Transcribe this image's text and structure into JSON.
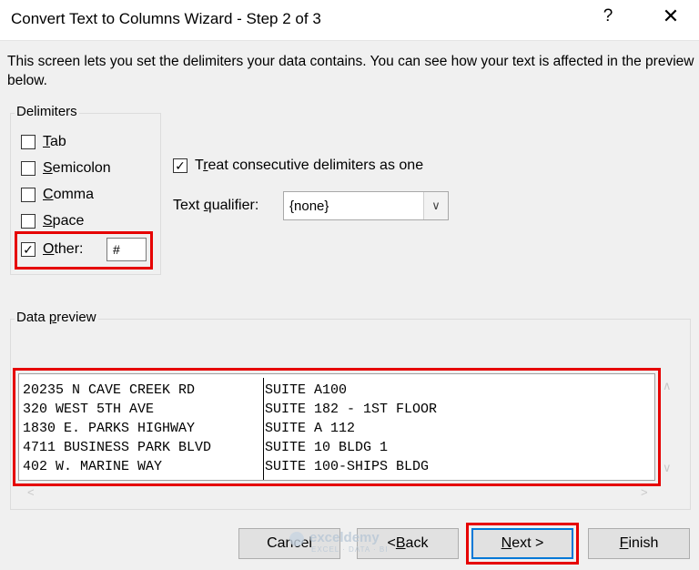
{
  "window": {
    "title": "Convert Text to Columns Wizard - Step 2 of 3",
    "help_glyph": "?",
    "close_glyph": "✕"
  },
  "description": "This screen lets you set the delimiters your data contains.  You can see how your text is affected in the preview below.",
  "delimiters": {
    "label": "Delimiters",
    "items": [
      {
        "key": "T",
        "rest": "ab",
        "checked": false
      },
      {
        "key": "S",
        "rest": "emicolon",
        "checked": false
      },
      {
        "key": "C",
        "rest": "omma",
        "checked": false
      },
      {
        "key": "S",
        "rest": "pace",
        "checked": false
      },
      {
        "key": "O",
        "rest": "ther:",
        "checked": true
      }
    ],
    "other_value": "#"
  },
  "options": {
    "consecutive_pre": "T",
    "consecutive_key": "r",
    "consecutive_rest": "eat consecutive delimiters as one",
    "consecutive_checked": true,
    "qualifier_pre": "Text ",
    "qualifier_key": "q",
    "qualifier_rest": "ualifier:",
    "qualifier_value": "{none}"
  },
  "preview": {
    "label_pre": "Data ",
    "label_key": "p",
    "label_rest": "review",
    "rows": [
      [
        "20235 N CAVE CREEK RD",
        "SUITE A100"
      ],
      [
        "320 WEST 5TH AVE",
        "SUITE 182 - 1ST FLOOR"
      ],
      [
        "1830 E. PARKS HIGHWAY",
        "SUITE A 112"
      ],
      [
        "4711 BUSINESS PARK BLVD",
        "SUITE 10 BLDG 1"
      ],
      [
        "402 W. MARINE WAY",
        "SUITE 100-SHIPS BLDG"
      ]
    ]
  },
  "buttons": {
    "cancel": "Cancel",
    "back_pre": "< ",
    "back_key": "B",
    "back_rest": "ack",
    "next_key": "N",
    "next_rest": "ext >",
    "finish_key": "F",
    "finish_rest": "inish"
  },
  "watermark": {
    "name": "exceldemy",
    "sub": "EXCEL · DATA · BI"
  },
  "colors": {
    "highlight": "#e60000",
    "focus": "#0078d7"
  }
}
